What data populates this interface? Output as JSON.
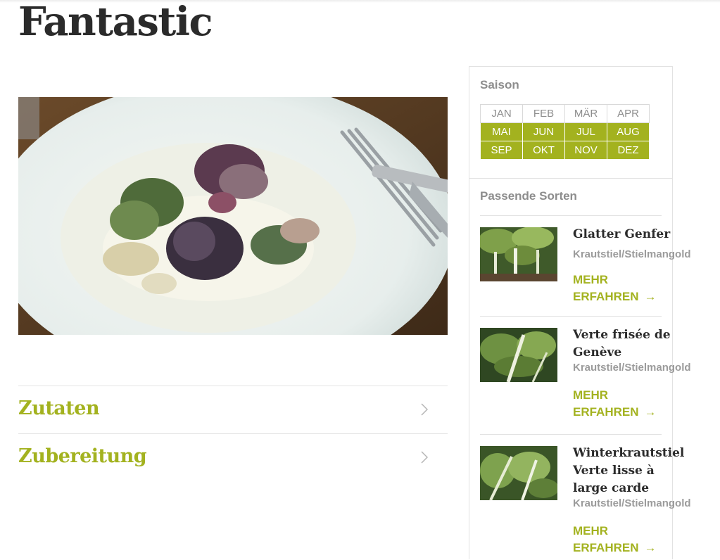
{
  "page": {
    "title": "Fantastic"
  },
  "accordion": [
    {
      "label": "Zutaten"
    },
    {
      "label": "Zubereitung"
    }
  ],
  "sidebar": {
    "season_heading": "Saison",
    "months": [
      {
        "label": "JAN",
        "active": false
      },
      {
        "label": "FEB",
        "active": false
      },
      {
        "label": "MÄR",
        "active": false
      },
      {
        "label": "APR",
        "active": false
      },
      {
        "label": "MAI",
        "active": true
      },
      {
        "label": "JUN",
        "active": true
      },
      {
        "label": "JUL",
        "active": true
      },
      {
        "label": "AUG",
        "active": true
      },
      {
        "label": "SEP",
        "active": true
      },
      {
        "label": "OKT",
        "active": true
      },
      {
        "label": "NOV",
        "active": true
      },
      {
        "label": "DEZ",
        "active": true
      }
    ],
    "varieties_heading": "Passende Sorten",
    "varieties": [
      {
        "name": "Glatter Genfer",
        "type": "Krautstiel/Stielmangold",
        "more_line1": "MEHR",
        "more_line2": "ERFAHREN",
        "arrow": "→"
      },
      {
        "name": "Verte frisée de Genève",
        "type": "Krautstiel/Stielmangold",
        "more_line1": "MEHR",
        "more_line2": "ERFAHREN",
        "arrow": "→"
      },
      {
        "name": "Winterkrautstiel Verte lisse à large carde",
        "type": "Krautstiel/Stielmangold",
        "more_line1": "MEHR",
        "more_line2": "ERFAHREN",
        "arrow": "→"
      }
    ]
  },
  "colors": {
    "accent": "#a3b21f",
    "text": "#2b2b2b",
    "muted": "#8d8d8d"
  }
}
